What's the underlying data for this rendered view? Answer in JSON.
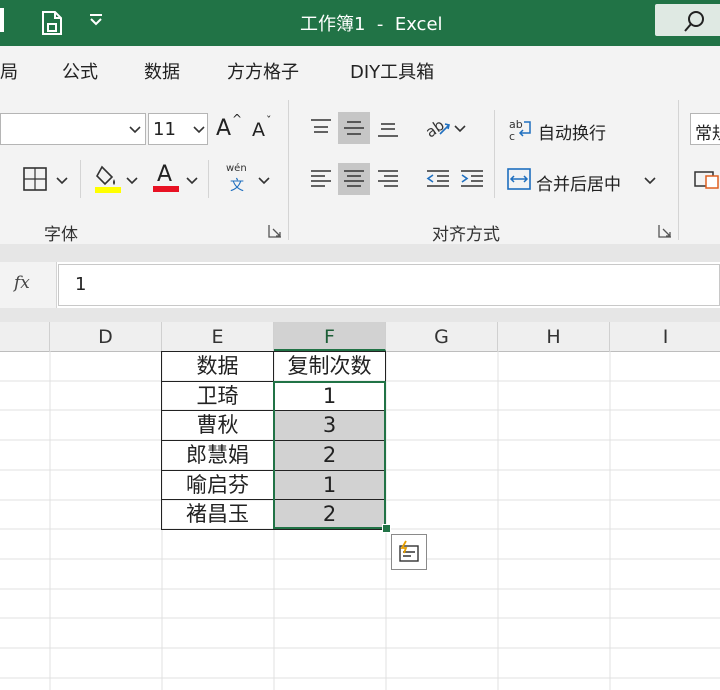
{
  "app": {
    "title": "工作簿1  -  Excel",
    "title_bar_color": "#217346"
  },
  "menu": {
    "items": [
      "局",
      "公式",
      "数据",
      "方方格子",
      "DIY工具箱"
    ]
  },
  "ribbon": {
    "font_group": {
      "label": "字体",
      "font_size": "11",
      "grow_font_label": "A",
      "shrink_font_label": "A",
      "phonetic_top": "wén",
      "phonetic_bottom": "文",
      "font_color_glyph": "A",
      "highlight_color": "#ffff00",
      "font_color": "#e81123"
    },
    "align_group": {
      "label": "对齐方式",
      "wrap_text_label": "自动换行",
      "merge_center_label": "合并后居中"
    },
    "number_group": {
      "format_value": "常规"
    }
  },
  "formula_bar": {
    "fx_label": "fx",
    "value": "1"
  },
  "columns": [
    "D",
    "E",
    "F",
    "G",
    "H",
    "I"
  ],
  "selected_column": "F",
  "table": {
    "headers": [
      "数据",
      "复制次数"
    ],
    "rows": [
      {
        "name": "卫琦",
        "count": "1"
      },
      {
        "name": "曹秋",
        "count": "3"
      },
      {
        "name": "郎慧娟",
        "count": "2"
      },
      {
        "name": "喻启芬",
        "count": "1"
      },
      {
        "name": "褚昌玉",
        "count": "2"
      }
    ]
  },
  "icons": {
    "save": "save-icon",
    "qat_more": "chevron-down-icon",
    "search": "search-icon",
    "quick_analysis": "quick-analysis-icon"
  }
}
